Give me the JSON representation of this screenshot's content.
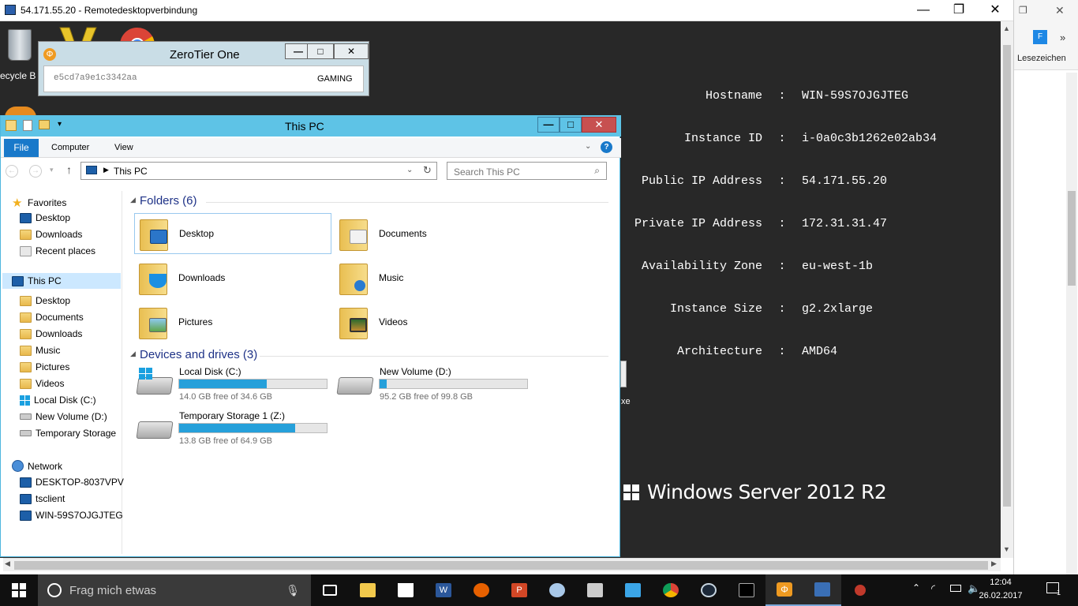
{
  "rdp": {
    "title": "54.171.55.20 - Remotedesktopverbindung",
    "minimize": "—",
    "maximize": "❐",
    "close": "✕"
  },
  "desktop": {
    "recycle_label": "ecycle B",
    "side_label": "xe"
  },
  "sysinfo": {
    "rows": [
      {
        "k": "Hostname",
        "v": "WIN-59S7OJGJTEG"
      },
      {
        "k": "Instance ID",
        "v": "i-0a0c3b1262e02ab34"
      },
      {
        "k": "Public IP Address",
        "v": "54.171.55.20"
      },
      {
        "k": "Private IP Address",
        "v": "172.31.31.47"
      },
      {
        "k": "Availability Zone",
        "v": "eu-west-1b"
      },
      {
        "k": "Instance Size",
        "v": "g2.2xlarge"
      },
      {
        "k": "Architecture",
        "v": "AMD64"
      }
    ],
    "separator": ":"
  },
  "windows_server": "Windows Server 2012 R2",
  "zerotier": {
    "title": "ZeroTier One",
    "network_id": "e5cd7a9e1c3342aa",
    "network_name": "GAMING",
    "min": "—",
    "max": "□",
    "close": "✕"
  },
  "explorer": {
    "title": "This PC",
    "min": "—",
    "max": "□",
    "close": "✕",
    "ribbon": {
      "file": "File",
      "computer": "Computer",
      "view": "View",
      "help": "?"
    },
    "address": "This PC",
    "search_placeholder": "Search This PC",
    "nav": {
      "favorites": "Favorites",
      "fav_items": [
        "Desktop",
        "Downloads",
        "Recent places"
      ],
      "thispc": "This PC",
      "pc_items": [
        "Desktop",
        "Documents",
        "Downloads",
        "Music",
        "Pictures",
        "Videos",
        "Local Disk (C:)",
        "New Volume (D:)",
        "Temporary Storage "
      ],
      "network": "Network",
      "net_items": [
        "DESKTOP-8037VPV",
        "tsclient",
        "WIN-59S7OJGJTEG"
      ]
    },
    "folders_header": "Folders (6)",
    "folders": [
      "Desktop",
      "Documents",
      "Downloads",
      "Music",
      "Pictures",
      "Videos"
    ],
    "drives_header": "Devices and drives (3)",
    "drives": [
      {
        "name": "Local Disk (C:)",
        "free": "14.0 GB free of 34.6 GB",
        "used_fraction": 0.595
      },
      {
        "name": "New Volume (D:)",
        "free": "95.2 GB free of 99.8 GB",
        "used_fraction": 0.046
      },
      {
        "name": "Temporary Storage 1 (Z:)",
        "free": "13.8 GB free of 64.9 GB",
        "used_fraction": 0.787
      }
    ]
  },
  "browser": {
    "bookmarks": "Lesezeichen"
  },
  "taskbar": {
    "search_placeholder": "Frag mich etwas",
    "time": "12:04",
    "date": "26.02.2017",
    "notifications": "1"
  }
}
